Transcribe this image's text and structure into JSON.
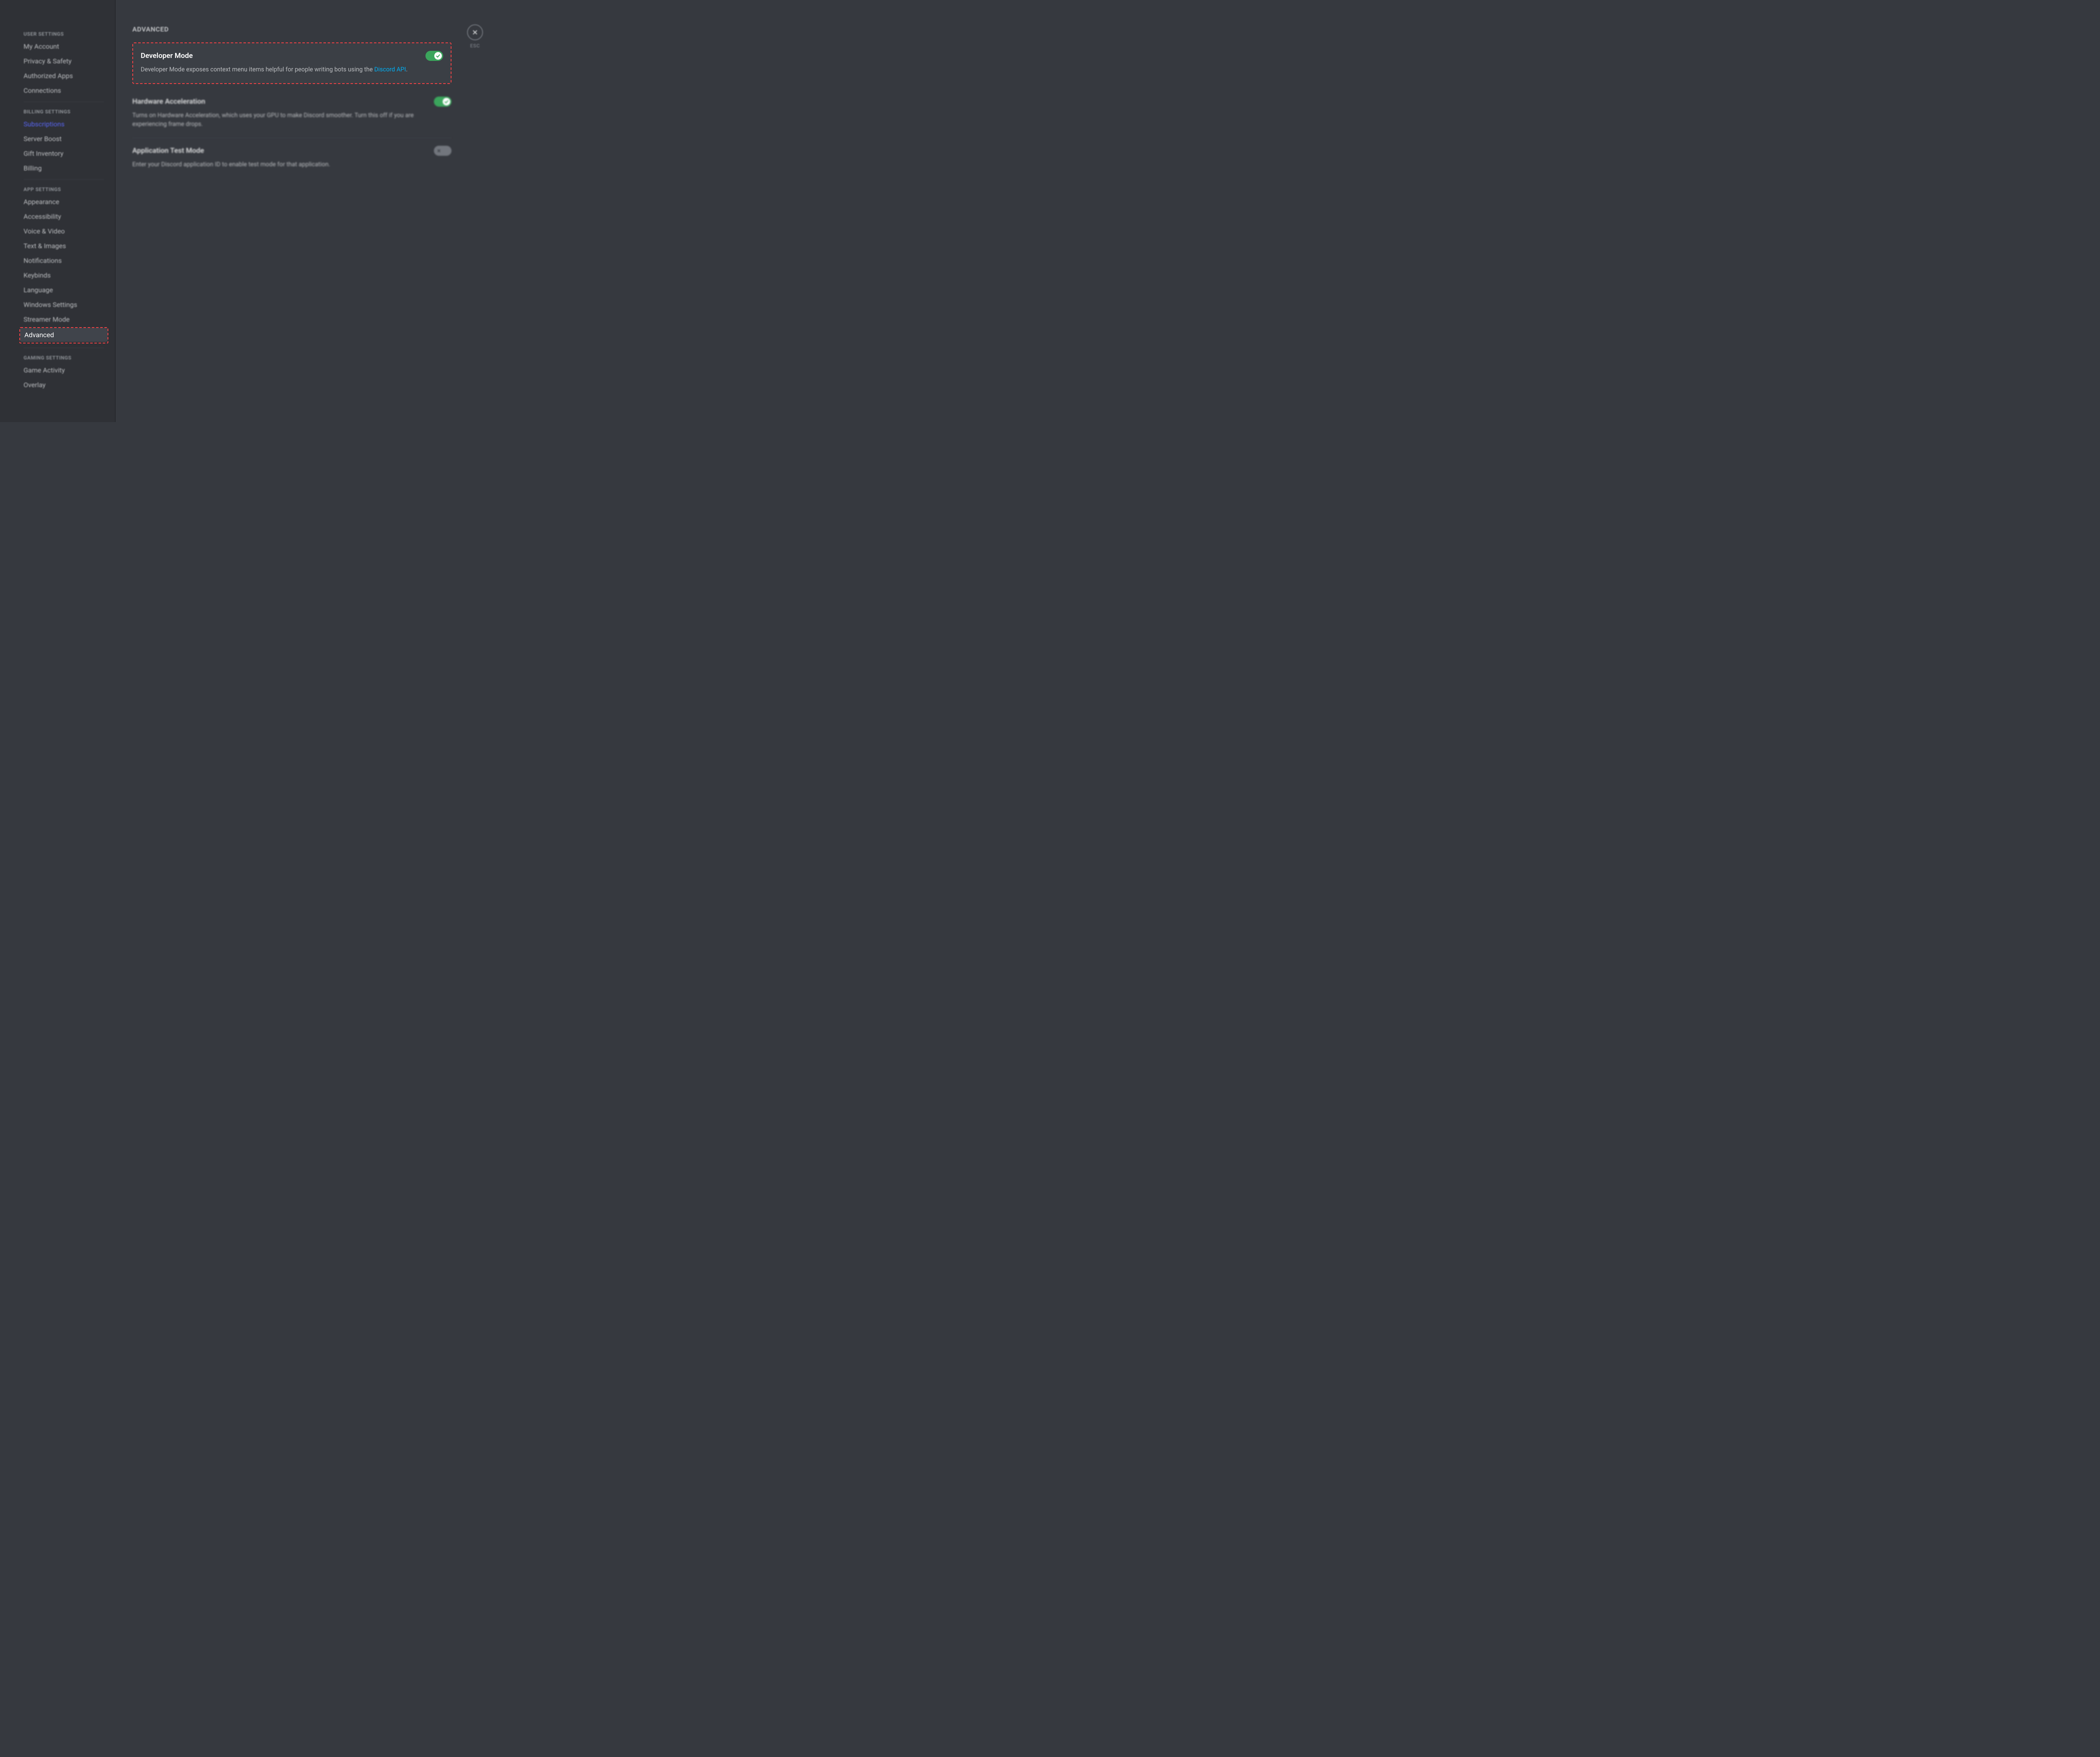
{
  "sidebar": {
    "sections": [
      {
        "header": "USER SETTINGS",
        "items": [
          {
            "label": "My Account",
            "name": "sidebar-item-my-account"
          },
          {
            "label": "Privacy & Safety",
            "name": "sidebar-item-privacy-safety"
          },
          {
            "label": "Authorized Apps",
            "name": "sidebar-item-authorized-apps"
          },
          {
            "label": "Connections",
            "name": "sidebar-item-connections"
          }
        ]
      },
      {
        "header": "BILLING SETTINGS",
        "items": [
          {
            "label": "Subscriptions",
            "name": "sidebar-item-subscriptions",
            "highlight": true
          },
          {
            "label": "Server Boost",
            "name": "sidebar-item-server-boost"
          },
          {
            "label": "Gift Inventory",
            "name": "sidebar-item-gift-inventory"
          },
          {
            "label": "Billing",
            "name": "sidebar-item-billing"
          }
        ]
      },
      {
        "header": "APP SETTINGS",
        "items": [
          {
            "label": "Appearance",
            "name": "sidebar-item-appearance"
          },
          {
            "label": "Accessibility",
            "name": "sidebar-item-accessibility"
          },
          {
            "label": "Voice & Video",
            "name": "sidebar-item-voice-video"
          },
          {
            "label": "Text & Images",
            "name": "sidebar-item-text-images"
          },
          {
            "label": "Notifications",
            "name": "sidebar-item-notifications"
          },
          {
            "label": "Keybinds",
            "name": "sidebar-item-keybinds"
          },
          {
            "label": "Language",
            "name": "sidebar-item-language"
          },
          {
            "label": "Windows Settings",
            "name": "sidebar-item-windows-settings"
          },
          {
            "label": "Streamer Mode",
            "name": "sidebar-item-streamer-mode"
          },
          {
            "label": "Advanced",
            "name": "sidebar-item-advanced",
            "selected": true
          }
        ]
      },
      {
        "header": "GAMING SETTINGS",
        "items": [
          {
            "label": "Game Activity",
            "name": "sidebar-item-game-activity"
          },
          {
            "label": "Overlay",
            "name": "sidebar-item-overlay"
          }
        ]
      }
    ]
  },
  "main": {
    "title": "ADVANCED",
    "settings": [
      {
        "title": "Developer Mode",
        "desc_pre": "Developer Mode exposes context menu items helpful for people writing bots using the ",
        "link": "Discord API",
        "desc_post": ".",
        "toggle": "on",
        "focused": true
      },
      {
        "title": "Hardware Acceleration",
        "desc": "Turns on Hardware Acceleration, which uses your GPU to make Discord smoother. Turn this off if you are experiencing frame drops.",
        "toggle": "on"
      },
      {
        "title": "Application Test Mode",
        "desc": "Enter your Discord application ID to enable test mode for that application.",
        "toggle": "off"
      }
    ],
    "close_label": "ESC"
  }
}
